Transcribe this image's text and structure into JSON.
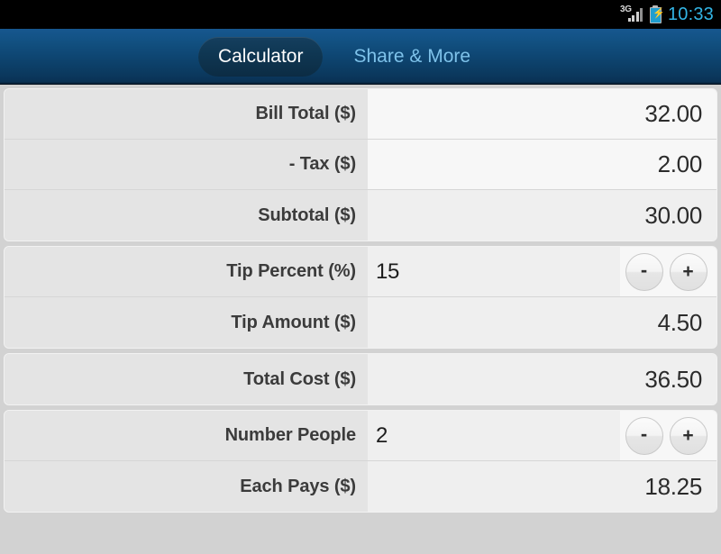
{
  "statusbar": {
    "network_label": "3G",
    "battery_icon": "battery-charging-icon",
    "signal_icon": "signal-bars-icon",
    "time": "10:33",
    "time_color": "#33b5e5"
  },
  "tabbar": {
    "tabs": [
      {
        "label": "Calculator",
        "active": true
      },
      {
        "label": "Share & More",
        "active": false
      }
    ]
  },
  "calculator": {
    "groups": [
      {
        "rows": [
          {
            "label": "Bill Total ($)",
            "value": "32.00",
            "type": "display",
            "shade": "light"
          },
          {
            "label": "- Tax ($)",
            "value": "2.00",
            "type": "display",
            "shade": "light"
          },
          {
            "label": "Subtotal ($)",
            "value": "30.00",
            "type": "display",
            "shade": "dim"
          }
        ]
      },
      {
        "rows": [
          {
            "label": "Tip Percent (%)",
            "value": "15",
            "type": "stepper",
            "minus": "-",
            "plus": "+"
          },
          {
            "label": "Tip Amount ($)",
            "value": "4.50",
            "type": "display",
            "shade": "dim"
          }
        ]
      },
      {
        "rows": [
          {
            "label": "Total Cost ($)",
            "value": "36.50",
            "type": "display",
            "shade": "dim"
          }
        ]
      },
      {
        "rows": [
          {
            "label": "Number People",
            "value": "2",
            "type": "stepper",
            "minus": "-",
            "plus": "+"
          },
          {
            "label": "Each Pays ($)",
            "value": "18.25",
            "type": "display",
            "shade": "dim"
          }
        ]
      }
    ]
  }
}
